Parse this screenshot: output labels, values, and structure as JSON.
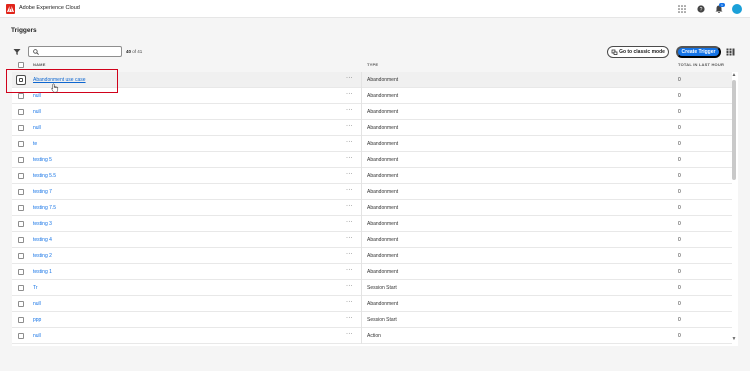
{
  "app": {
    "title": "Adobe Experience Cloud",
    "logo_icon": "adobe-logo-icon",
    "notification_count": "1",
    "accent": "#1473e6",
    "brand": "#e1251b"
  },
  "page": {
    "title": "Triggers"
  },
  "toolbar": {
    "search_placeholder": "",
    "count_shown": "40",
    "count_rest": "of 41",
    "classic_label": "Go to classic mode",
    "create_label": "Create Trigger"
  },
  "columns": {
    "name": "NAME",
    "type": "TYPE",
    "total": "TOTAL IN LAST HOUR"
  },
  "rows": [
    {
      "name": "Abandonment use case",
      "type": "Abandonment",
      "total": "0"
    },
    {
      "name": "null",
      "type": "Abandonment",
      "total": "0"
    },
    {
      "name": "null",
      "type": "Abandonment",
      "total": "0"
    },
    {
      "name": "null",
      "type": "Abandonment",
      "total": "0"
    },
    {
      "name": "te",
      "type": "Abandonment",
      "total": "0"
    },
    {
      "name": "testing 5",
      "type": "Abandonment",
      "total": "0"
    },
    {
      "name": "testing 5.5",
      "type": "Abandonment",
      "total": "0"
    },
    {
      "name": "testing 7",
      "type": "Abandonment",
      "total": "0"
    },
    {
      "name": "testing 7.5",
      "type": "Abandonment",
      "total": "0"
    },
    {
      "name": "testing 3",
      "type": "Abandonment",
      "total": "0"
    },
    {
      "name": "testing 4",
      "type": "Abandonment",
      "total": "0"
    },
    {
      "name": "testing 2",
      "type": "Abandonment",
      "total": "0"
    },
    {
      "name": "testing 1",
      "type": "Abandonment",
      "total": "0"
    },
    {
      "name": "Tr",
      "type": "Session Start",
      "total": "0"
    },
    {
      "name": "null",
      "type": "Abandonment",
      "total": "0"
    },
    {
      "name": "ppp",
      "type": "Session Start",
      "total": "0"
    },
    {
      "name": "null",
      "type": "Action",
      "total": "0"
    }
  ],
  "more_glyph": "···",
  "highlight_color": "#d0021b"
}
